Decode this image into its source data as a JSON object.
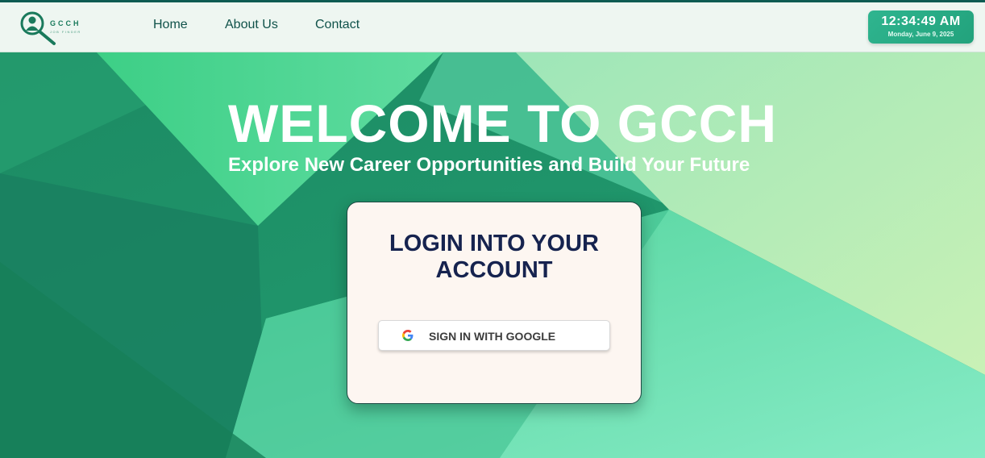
{
  "header": {
    "logo": {
      "name": "GCCH",
      "tagline": "JOB FINDER",
      "icon": "magnifier-person-icon"
    },
    "nav": [
      {
        "label": "Home"
      },
      {
        "label": "About Us"
      },
      {
        "label": "Contact"
      }
    ],
    "clock": {
      "time": "12:34:49 AM",
      "date": "Monday, June 9, 2025"
    }
  },
  "hero": {
    "title": "WELCOME TO GCCH",
    "subtitle": "Explore New Career Opportunities and Build Your Future"
  },
  "login": {
    "title": "LOGIN INTO YOUR ACCOUNT",
    "google_button": {
      "label": "SIGN IN WITH GOOGLE",
      "icon": "google-icon"
    }
  },
  "colors": {
    "header_bg": "#eef6f1",
    "nav_text": "#10524a",
    "clock_bg": "#2fb58f",
    "card_bg": "#fdf6f1",
    "card_title": "#16234f",
    "accent_green": "#2bb07a"
  }
}
